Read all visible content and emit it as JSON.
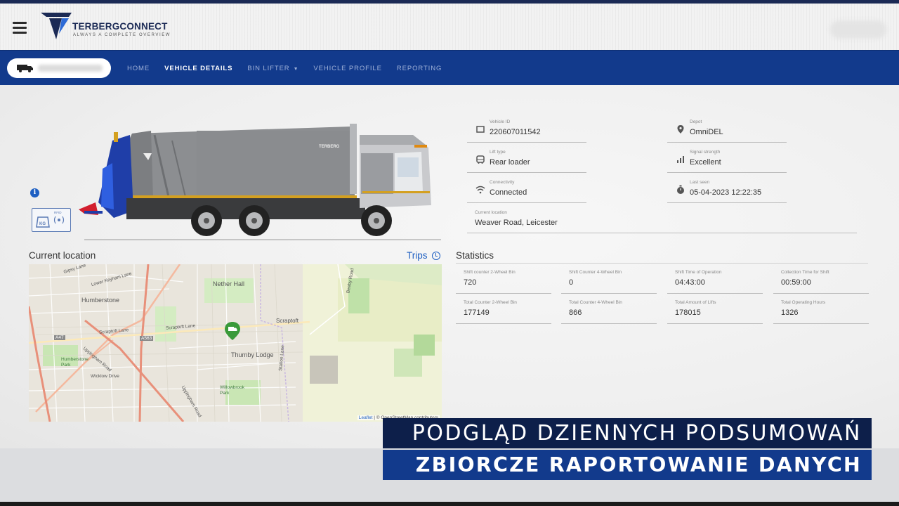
{
  "header": {
    "logo_text": "TERBERGCONNECT",
    "logo_tagline": "ALWAYS A COMPLETE OVERVIEW",
    "menu_icon": "hamburger-icon"
  },
  "nav": {
    "items": [
      {
        "label": "HOME",
        "active": false
      },
      {
        "label": "VEHICLE DETAILS",
        "active": true
      },
      {
        "label": "BIN LIFTER",
        "active": false,
        "dropdown": true
      },
      {
        "label": "VEHICLE PROFILE",
        "active": false
      },
      {
        "label": "REPORTING",
        "active": false
      }
    ],
    "vehicle_icon": "truck-icon"
  },
  "truck": {
    "rfid_label": "RFID",
    "kg_label": "KG",
    "brand_label": "TERBERG"
  },
  "details": {
    "vehicle_id": {
      "label": "Vehicle ID",
      "value": "220607011542",
      "icon": "vehicle-id-icon"
    },
    "lift_type": {
      "label": "Lift type",
      "value": "Rear loader",
      "icon": "bus-icon"
    },
    "connectivity": {
      "label": "Connectivity",
      "value": "Connected",
      "icon": "wifi-icon"
    },
    "depot": {
      "label": "Depot",
      "value": "OmniDEL",
      "icon": "location-pin-icon"
    },
    "signal": {
      "label": "Signal strength",
      "value": "Excellent",
      "icon": "signal-bars-icon"
    },
    "last_seen": {
      "label": "Last seen",
      "value": "05-04-2023 12:22:35",
      "icon": "stopwatch-icon"
    },
    "current_location": {
      "label": "Current location",
      "value": "Weaver Road, Leicester"
    }
  },
  "map": {
    "title": "Current location",
    "trips_label": "Trips",
    "places": [
      "Gipsy Lane",
      "Lower Keyham Lane",
      "Nether Hall",
      "Humberstone",
      "Scraptoft Lane",
      "Scraptoft",
      "A47",
      "A563",
      "Uppingham Road",
      "Humberstone Park",
      "Thurnby Lodge",
      "Station Lane",
      "Wicklow Drive",
      "Willowbrook Park",
      "Beeby Road",
      "Uppingham Road"
    ],
    "attribution_leaflet": "Leaflet",
    "attribution_rest": "| © OpenStreetMap contributors"
  },
  "statistics": {
    "title": "Statistics",
    "items": [
      {
        "label": "Shift counter 2-Wheel Bin",
        "value": "720"
      },
      {
        "label": "Shift Counter 4-Wheel Bin",
        "value": "0"
      },
      {
        "label": "Shift Time of Operation",
        "value": "04:43:00"
      },
      {
        "label": "Collection Time for Shift",
        "value": "00:59:00"
      },
      {
        "label": "Total Counter 2-Wheel Bin",
        "value": "177149"
      },
      {
        "label": "Total Counter 4-Wheel Bin",
        "value": "866"
      },
      {
        "label": "Total Amount of Lifts",
        "value": "178015"
      },
      {
        "label": "Total Operating Hours",
        "value": "1326"
      }
    ]
  },
  "captions": {
    "line1": "PODGLĄD DZIENNYCH PODSUMOWAŃ",
    "line2": "ZBIORCZE RAPORTOWANIE DANYCH"
  },
  "colors": {
    "brand_navy": "#1b2a55",
    "nav_blue": "#123a8c",
    "link_blue": "#1e5fc2",
    "truck_grey": "#8a8c8f",
    "lifter_blue": "#1f3ea8"
  }
}
